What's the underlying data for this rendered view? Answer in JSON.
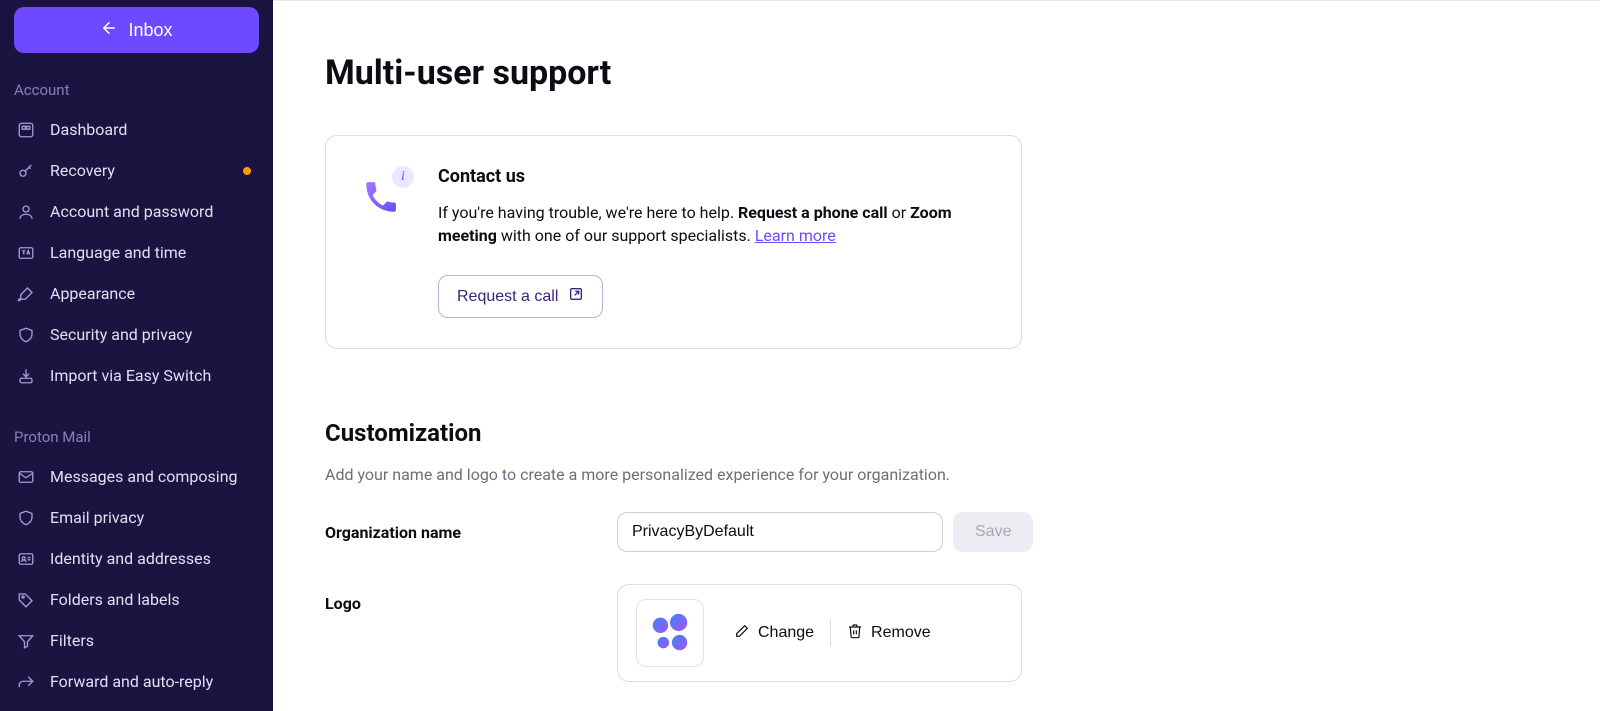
{
  "header": {
    "inbox_button": "Inbox"
  },
  "sidebar": {
    "sections": {
      "account_label": "Account",
      "mail_label": "Proton Mail"
    },
    "account_items": [
      {
        "label": "Dashboard"
      },
      {
        "label": "Recovery",
        "badge": true
      },
      {
        "label": "Account and password"
      },
      {
        "label": "Language and time"
      },
      {
        "label": "Appearance"
      },
      {
        "label": "Security and privacy"
      },
      {
        "label": "Import via Easy Switch"
      }
    ],
    "mail_items": [
      {
        "label": "Messages and composing"
      },
      {
        "label": "Email privacy"
      },
      {
        "label": "Identity and addresses"
      },
      {
        "label": "Folders and labels"
      },
      {
        "label": "Filters"
      },
      {
        "label": "Forward and auto-reply"
      }
    ]
  },
  "page": {
    "title": "Multi-user support"
  },
  "contact": {
    "title": "Contact us",
    "text_pre": "If you're having trouble, we're here to help. ",
    "text_b1": "Request a phone call",
    "text_mid": " or ",
    "text_b2": "Zoom meeting",
    "text_post": " with one of our support specialists. ",
    "learn_more": "Learn more",
    "button": "Request a call"
  },
  "customization": {
    "title": "Customization",
    "desc": "Add your name and logo to create a more personalized experience for your organization.",
    "org_label": "Organization name",
    "org_value": "PrivacyByDefault",
    "save_label": "Save",
    "logo_label": "Logo",
    "change_label": "Change",
    "remove_label": "Remove"
  }
}
